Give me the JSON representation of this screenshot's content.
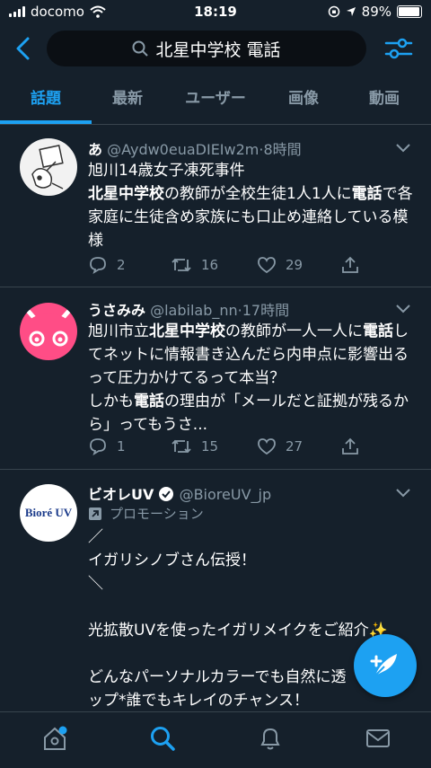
{
  "status_bar": {
    "carrier": "docomo",
    "time": "18:19",
    "battery_percent": "89%",
    "battery_level": 0.89
  },
  "search": {
    "query": "北星中学校 電話"
  },
  "tabs": [
    {
      "label": "話題",
      "active": true
    },
    {
      "label": "最新"
    },
    {
      "label": "ユーザー"
    },
    {
      "label": "画像"
    },
    {
      "label": "動画"
    }
  ],
  "tweets": [
    {
      "name": "あ",
      "handle": "@Aydw0euaDIEIw2m",
      "time": "8時間",
      "body": [
        {
          "text": "旭川14歳女子凍死事件"
        },
        {
          "text": "北星中学校",
          "bold": true
        },
        {
          "text": "の教師が全校生徒1人1人に"
        },
        {
          "text": "電話",
          "bold": true
        },
        {
          "text": "で各家庭に生徒含め家族にも口止め連絡している模様"
        }
      ],
      "replies": "2",
      "retweets": "16",
      "likes": "29"
    },
    {
      "name": "うさみみ",
      "handle": "@labilab_nn",
      "time": "17時間",
      "body": [
        {
          "text": "旭川市立"
        },
        {
          "text": "北星中学校",
          "bold": true
        },
        {
          "text": "の教師が一人一人に"
        },
        {
          "text": "電話",
          "bold": true
        },
        {
          "text": "してネットに情報書き込んだら内申点に影響出るって圧力かけてるって本当？"
        },
        {
          "text": "しかも"
        },
        {
          "text": "電話",
          "bold": true
        },
        {
          "text": "の理由が「メールだと証拠が残るから」ってもうさ..."
        }
      ],
      "replies": "1",
      "retweets": "15",
      "likes": "27"
    },
    {
      "name": "ビオレUV",
      "handle": "@BioreUV_jp",
      "promo_label": "プロモーション",
      "avatar_logo": "Bioré UV",
      "lines": [
        "／",
        "イガリシノブさん伝授！",
        "＼",
        "",
        "光拡散UVを使ったイガリメイクをご紹介✨",
        "",
        "どんなパーソナルカラーでも自然に透",
        "ップ*誰でもキレイのチャンス！"
      ]
    }
  ],
  "icons": {
    "accent": "#1da1f2",
    "muted": "#8899a6",
    "back": "back-arrow-icon",
    "search": "search-icon",
    "filter": "filter-icon",
    "reply": "reply-icon",
    "retweet": "retweet-icon",
    "like": "heart-icon",
    "share": "share-icon",
    "compose": "compose-tweet-icon",
    "home": "home-icon",
    "explore": "search-icon",
    "notifications": "bell-icon",
    "messages": "mail-icon"
  }
}
